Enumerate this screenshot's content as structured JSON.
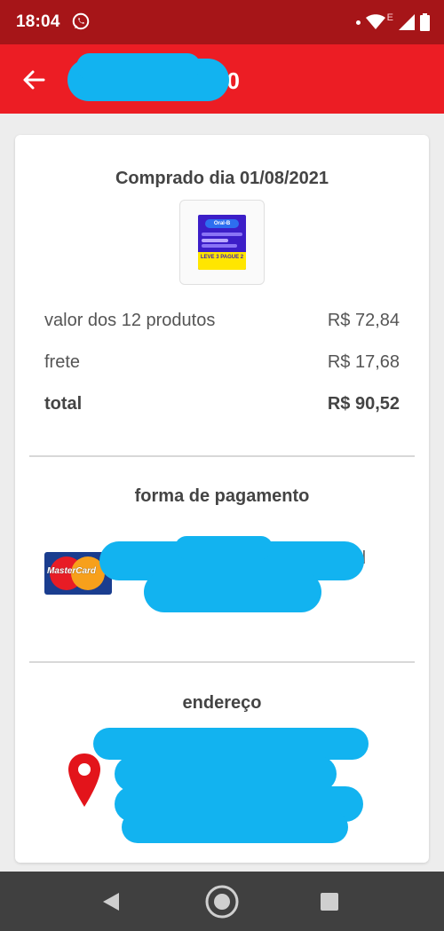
{
  "status_bar": {
    "time": "18:04",
    "network_label": "E",
    "icons": [
      "whatsapp-icon",
      "wifi-icon",
      "signal-icon",
      "battery-icon"
    ]
  },
  "app_bar": {
    "title_visible_tail": "0",
    "back_icon": "arrow-left-icon",
    "background": "#ec1d24"
  },
  "order": {
    "purchase_date_title": "Comprado dia 01/08/2021",
    "product_image": {
      "brand": "Oral-B",
      "promo": "LEVE 3 PAGUE 2"
    },
    "summary": [
      {
        "label": "valor dos 12 produtos",
        "value": "R$ 72,84"
      },
      {
        "label": "frete",
        "value": "R$ 17,68"
      },
      {
        "label": "total",
        "value": "R$ 90,52"
      }
    ]
  },
  "payment": {
    "title": "forma de pagamento",
    "card_brand": "MasterCard",
    "visible_text_fragment": "d"
  },
  "address": {
    "title": "endereço",
    "icon": "location-pin-icon"
  },
  "nav_bar": {
    "buttons": [
      "back-triangle-icon",
      "home-circle-icon",
      "recents-square-icon"
    ]
  },
  "colors": {
    "status_bar": "#a61518",
    "app_bar": "#ec1d24",
    "redaction": "#12b3f0",
    "pin": "#e3141b",
    "nav_bar": "#404040"
  }
}
